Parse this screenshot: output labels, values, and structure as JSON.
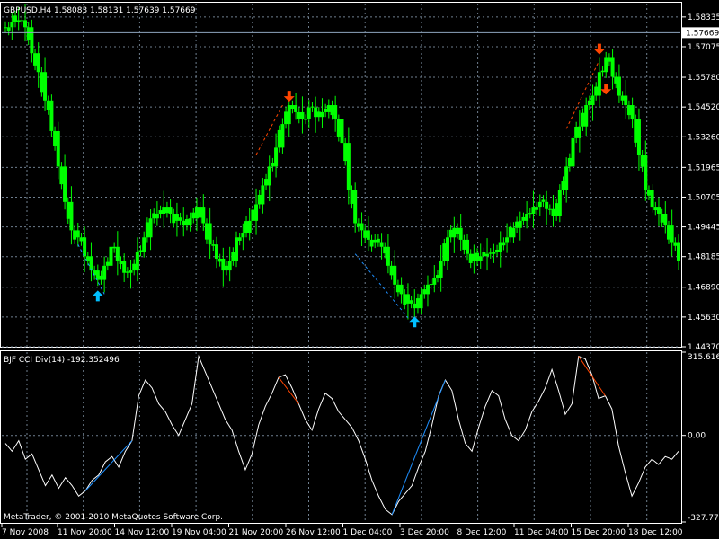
{
  "header": {
    "title": "GBPUSD,H4  1.58083 1.58131 1.57639 1.57669"
  },
  "indicator": {
    "label": "BJF CCI Div(14) -192.352496"
  },
  "footer": {
    "copyright": "MetaTrader, © 2001-2010 MetaQuotes Software Corp."
  },
  "colors": {
    "background": "#000000",
    "grid": "#6f7f8f",
    "frame": "#ffffff",
    "candle": "#00ff00",
    "cci_line": "#ffffff",
    "bullish_divergence": "#1e90ff",
    "bearish_divergence": "#ff4500",
    "bull_arrow": "#00bfff",
    "bear_arrow": "#ff4500",
    "price_line": "#8fa6bf"
  },
  "chart_data": [
    {
      "type": "candlestick",
      "symbol": "GBPUSD",
      "timeframe": "H4",
      "current_price": "1.57669",
      "ylim": [
        1.4437,
        1.589
      ],
      "y_ticks": [
        "1.58335",
        "1.57075",
        "1.55780",
        "1.54520",
        "1.53260",
        "1.51965",
        "1.50705",
        "1.49445",
        "1.48185",
        "1.46890",
        "1.45630",
        "1.44370"
      ],
      "y_tick_values": [
        1.58335,
        1.57075,
        1.5578,
        1.5452,
        1.5326,
        1.51965,
        1.50705,
        1.49445,
        1.48185,
        1.4689,
        1.4563,
        1.4437
      ],
      "x_ticks": [
        "7 Nov 2008",
        "11 Nov 20:00",
        "14 Nov 12:00",
        "19 Nov 04:00",
        "21 Nov 20:00",
        "26 Nov 12:00",
        "1 Dec 04:00",
        "3 Dec 20:00",
        "8 Dec 12:00",
        "11 Dec 04:00",
        "15 Dec 20:00",
        "18 Dec 12:00"
      ],
      "close_path": [
        1.579,
        1.581,
        1.582,
        1.579,
        1.568,
        1.56,
        1.548,
        1.535,
        1.52,
        1.505,
        1.493,
        1.49,
        1.482,
        1.476,
        1.472,
        1.478,
        1.486,
        1.48,
        1.475,
        1.476,
        1.484,
        1.49,
        1.498,
        1.5,
        1.503,
        1.5,
        1.497,
        1.495,
        1.498,
        1.503,
        1.496,
        1.487,
        1.481,
        1.476,
        1.48,
        1.49,
        1.492,
        1.497,
        1.504,
        1.512,
        1.52,
        1.528,
        1.538,
        1.546,
        1.543,
        1.54,
        1.545,
        1.541,
        1.543,
        1.546,
        1.54,
        1.53,
        1.51,
        1.496,
        1.493,
        1.489,
        1.488,
        1.486,
        1.478,
        1.47,
        1.466,
        1.462,
        1.46,
        1.466,
        1.47,
        1.473,
        1.48,
        1.49,
        1.494,
        1.489,
        1.483,
        1.48,
        1.482,
        1.483,
        1.484,
        1.488,
        1.49,
        1.494,
        1.497,
        1.5,
        1.503,
        1.505,
        1.502,
        1.499,
        1.51,
        1.52,
        1.532,
        1.537,
        1.546,
        1.55,
        1.56,
        1.566,
        1.558,
        1.55,
        1.546,
        1.54,
        1.525,
        1.51,
        1.503,
        1.5,
        1.495,
        1.488,
        1.48
      ],
      "price_line": 1.57669,
      "bull_arrows": [
        {
          "index": 14,
          "price": 1.466
        },
        {
          "index": 62,
          "price": 1.455
        }
      ],
      "bear_arrows": [
        {
          "index": 43,
          "price": 1.549
        },
        {
          "index": 90,
          "price": 1.569
        },
        {
          "index": 91,
          "price": 1.552
        }
      ],
      "divergence_lines": [
        {
          "from_index": 11,
          "from_price": 1.487,
          "to_index": 15,
          "to_price": 1.466,
          "direction": "bullish"
        },
        {
          "from_index": 53,
          "from_price": 1.483,
          "to_index": 61,
          "to_price": 1.456,
          "direction": "bullish"
        },
        {
          "from_index": 38,
          "from_price": 1.525,
          "to_index": 42,
          "to_price": 1.546,
          "direction": "bearish"
        },
        {
          "from_index": 85,
          "from_price": 1.536,
          "to_index": 90,
          "to_price": 1.565,
          "direction": "bearish"
        }
      ]
    },
    {
      "type": "line",
      "name": "BJF CCI Div(14)",
      "ylim": [
        -327.775,
        315.6164
      ],
      "y_ticks": [
        "315.6164",
        "0.00",
        "-327.775"
      ],
      "y_tick_values": [
        315.6164,
        0,
        -327.775
      ],
      "values": [
        -30,
        -60,
        -20,
        -90,
        -70,
        -130,
        -190,
        -150,
        -200,
        -160,
        -190,
        -230,
        -210,
        -170,
        -150,
        -100,
        -80,
        -120,
        -60,
        -20,
        150,
        210,
        180,
        120,
        90,
        40,
        0,
        60,
        120,
        300,
        240,
        180,
        120,
        60,
        20,
        -60,
        -130,
        -70,
        40,
        110,
        160,
        220,
        230,
        180,
        120,
        60,
        20,
        100,
        160,
        140,
        90,
        60,
        30,
        -20,
        -90,
        -170,
        -230,
        -280,
        -300,
        -250,
        -220,
        -190,
        -120,
        -60,
        40,
        150,
        210,
        170,
        60,
        -30,
        -60,
        30,
        110,
        170,
        150,
        60,
        0,
        -20,
        20,
        90,
        130,
        180,
        250,
        170,
        80,
        120,
        300,
        290,
        230,
        140,
        150,
        100,
        -40,
        -140,
        -230,
        -180,
        -120,
        -90,
        -110,
        -80,
        -90,
        -60
      ]
    }
  ]
}
